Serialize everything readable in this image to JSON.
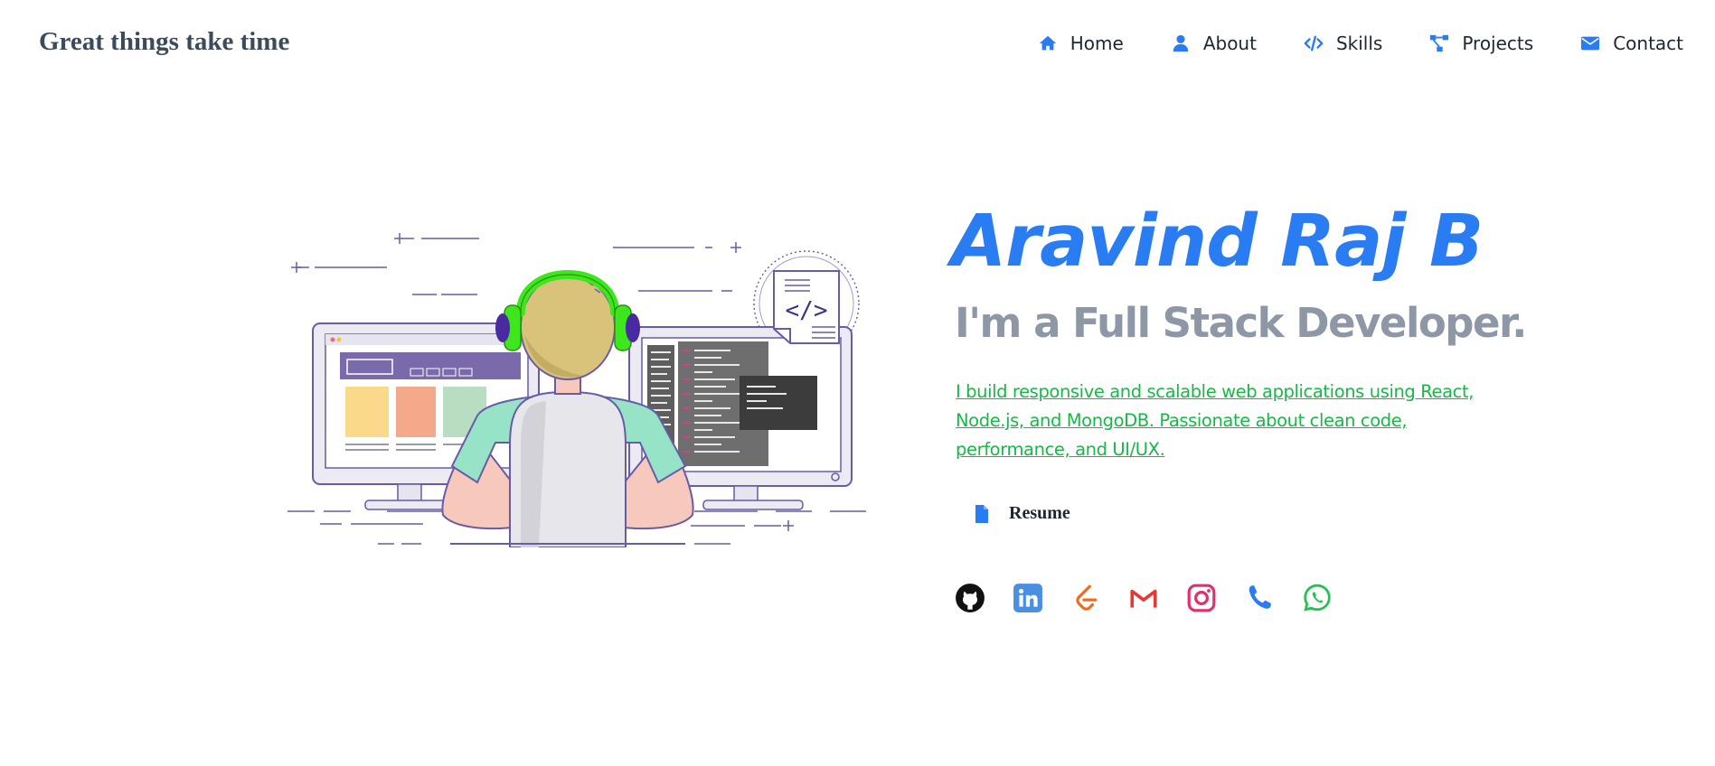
{
  "header": {
    "brand": "Great things take time",
    "nav": [
      {
        "label": "Home",
        "icon": "home-icon"
      },
      {
        "label": "About",
        "icon": "user-icon"
      },
      {
        "label": "Skills",
        "icon": "code-icon"
      },
      {
        "label": "Projects",
        "icon": "project-diagram-icon"
      },
      {
        "label": "Contact",
        "icon": "envelope-icon"
      }
    ]
  },
  "hero": {
    "name": "Aravind Raj B",
    "role": "I'm a Full Stack Developer.",
    "bio": "I build responsive and scalable web applications using React, Node.js, and MongoDB. Passionate about clean code, performance, and UI/UX.",
    "resume_label": "Resume",
    "socials": [
      "github-icon",
      "linkedin-icon",
      "leetcode-icon",
      "gmail-icon",
      "instagram-icon",
      "phone-icon",
      "whatsapp-icon"
    ]
  },
  "colors": {
    "accent": "#2a7cf2",
    "role_text": "#8d97a5",
    "bio_text": "#17b845",
    "brand_text": "#3c4b5c",
    "headphones": "#3ee61c",
    "illustration_outline": "#6a5aa8"
  }
}
